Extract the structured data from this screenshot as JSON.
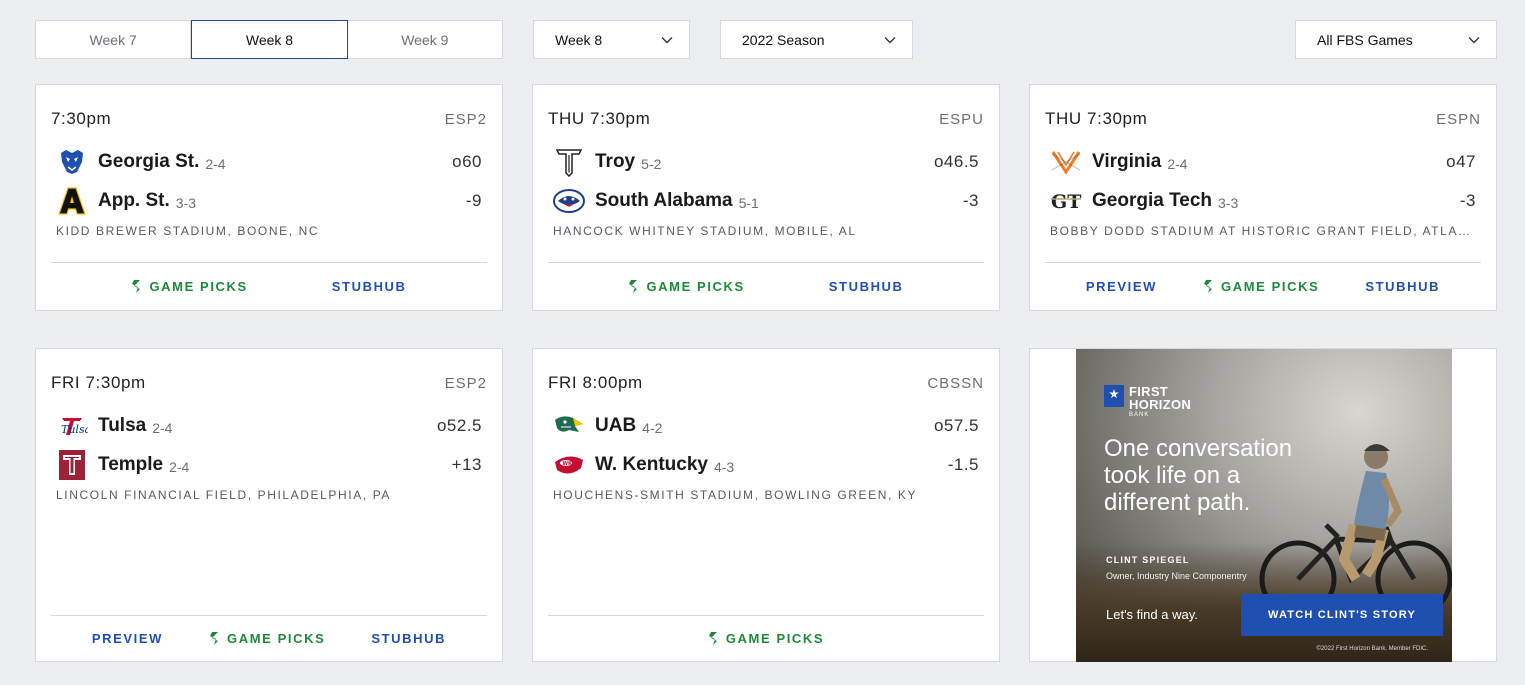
{
  "week_tabs": [
    {
      "label": "Week 7",
      "active": false
    },
    {
      "label": "Week 8",
      "active": true
    },
    {
      "label": "Week 9",
      "active": false
    }
  ],
  "filters": {
    "week": "Week 8",
    "season": "2022 Season",
    "games": "All FBS Games"
  },
  "games": [
    {
      "time": "7:30pm",
      "network": "ESP2",
      "away": {
        "name": "Georgia St.",
        "record": "2-4",
        "line": "o60",
        "logo": "georgia-state-panther-logo"
      },
      "home": {
        "name": "App. St.",
        "record": "3-3",
        "line": "-9",
        "logo": "app-state-a-logo"
      },
      "venue": "KIDD BREWER STADIUM, BOONE, NC",
      "links": {
        "preview": null,
        "picks": "GAME PICKS",
        "stubhub": "STUBHUB"
      }
    },
    {
      "time": "THU 7:30pm",
      "network": "ESPU",
      "away": {
        "name": "Troy",
        "record": "5-2",
        "line": "o46.5",
        "logo": "troy-t-logo"
      },
      "home": {
        "name": "South Alabama",
        "record": "5-1",
        "line": "-3",
        "logo": "south-alabama-jaguar-logo"
      },
      "venue": "HANCOCK WHITNEY STADIUM, MOBILE, AL",
      "links": {
        "preview": null,
        "picks": "GAME PICKS",
        "stubhub": "STUBHUB"
      }
    },
    {
      "time": "THU 7:30pm",
      "network": "ESPN",
      "away": {
        "name": "Virginia",
        "record": "2-4",
        "line": "o47",
        "logo": "virginia-sabres-logo"
      },
      "home": {
        "name": "Georgia Tech",
        "record": "3-3",
        "line": "-3",
        "logo": "georgia-tech-gt-logo"
      },
      "venue": "BOBBY DODD STADIUM AT HISTORIC GRANT FIELD, ATLANTA…",
      "links": {
        "preview": "PREVIEW",
        "picks": "GAME PICKS",
        "stubhub": "STUBHUB"
      }
    },
    {
      "time": "FRI 7:30pm",
      "network": "ESP2",
      "away": {
        "name": "Tulsa",
        "record": "2-4",
        "line": "o52.5",
        "logo": "tulsa-script-logo"
      },
      "home": {
        "name": "Temple",
        "record": "2-4",
        "line": "+13",
        "logo": "temple-t-logo"
      },
      "venue": "LINCOLN FINANCIAL FIELD, PHILADELPHIA, PA",
      "links": {
        "preview": "PREVIEW",
        "picks": "GAME PICKS",
        "stubhub": "STUBHUB"
      }
    },
    {
      "time": "FRI 8:00pm",
      "network": "CBSSN",
      "away": {
        "name": "UAB",
        "record": "4-2",
        "line": "o57.5",
        "logo": "uab-dragon-logo"
      },
      "home": {
        "name": "W. Kentucky",
        "record": "4-3",
        "line": "-1.5",
        "logo": "wku-towel-logo"
      },
      "venue": "HOUCHENS-SMITH STADIUM, BOWLING GREEN, KY",
      "links": {
        "preview": null,
        "picks": "GAME PICKS",
        "stubhub": null
      }
    }
  ],
  "ad": {
    "brand_line1": "FIRST",
    "brand_line2": "HORIZON",
    "brand_sub": "BANK",
    "headline": "One conversation took life on a different path.",
    "name": "CLINT SPIEGEL",
    "title": "Owner, Industry Nine Componentry",
    "tagline": "Let's find a way.",
    "cta": "WATCH CLINT'S STORY",
    "legal": "©2022 First Horizon Bank. Member FDIC."
  },
  "colors": {
    "page_bg": "#edeef2",
    "link_blue": "#1f4fb0",
    "picks_green": "#1d8a3b",
    "active_tab_border": "#1f4a8c"
  }
}
